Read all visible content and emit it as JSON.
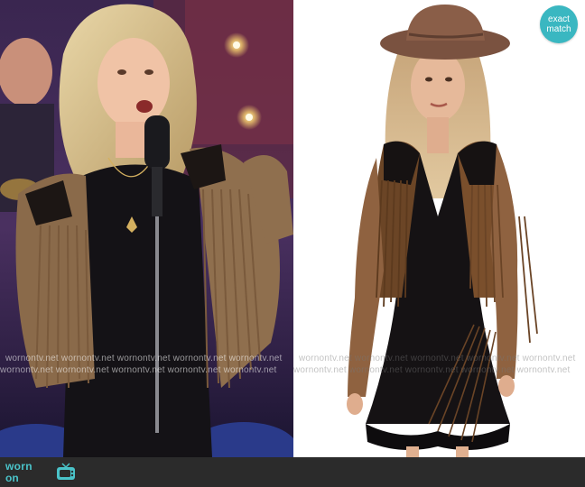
{
  "watermark": {
    "row_1": "wornontv.net  wornontv.net  wornontv.net  wornontv.net  wornontv.net",
    "row_2": "wornontv.net  wornontv.net  wornontv.net  wornontv.net  wornontv.net",
    "row_3": "wornontv.net  wornontv.net  wornontv.net  wornontv.net  wornontv.net",
    "row_4": "wornontv.net  wornontv.net  wornontv.net  wornontv.net  wornontv.net"
  },
  "badge": {
    "line_1": "exact",
    "line_2": "match"
  },
  "logo": {
    "line_1": "worn",
    "line_2": "on",
    "icon": "tv-icon"
  },
  "colors": {
    "accent": "#3ab7c1",
    "logo_text": "#4ac3c9",
    "footer": "#2b2b2b"
  }
}
